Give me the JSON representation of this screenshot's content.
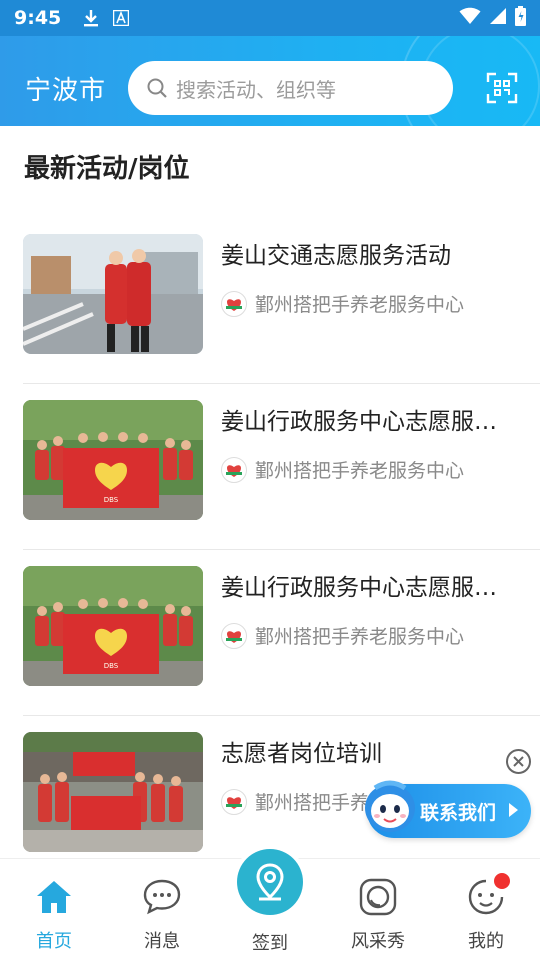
{
  "status_bar": {
    "time": "9:45",
    "icons": [
      "download-icon",
      "a-icon",
      "wifi-icon",
      "signal-icon",
      "battery-icon"
    ]
  },
  "header": {
    "city": "宁波市",
    "search_placeholder": "搜索活动、组织等",
    "scan_icon": "scan-icon",
    "accent": "#1fa9ef"
  },
  "section": {
    "title": "最新活动/岗位"
  },
  "items": [
    {
      "title": "姜山交通志愿服务活动",
      "org": "鄞州搭把手养老服务中心",
      "thumb": "traffic-volunteers-photo"
    },
    {
      "title": "姜山行政服务中心志愿服…",
      "org": "鄞州搭把手养老服务中心",
      "thumb": "group-with-banner-photo"
    },
    {
      "title": "姜山行政服务中心志愿服…",
      "org": "鄞州搭把手养老服务中心",
      "thumb": "group-with-banner-photo"
    },
    {
      "title": "志愿者岗位培训",
      "org": "鄞州搭把手养老服务中心",
      "thumb": "training-group-photo"
    }
  ],
  "float": {
    "contact_label": "联系我们"
  },
  "tabs": [
    {
      "label": "首页",
      "icon": "home-icon",
      "active": true
    },
    {
      "label": "消息",
      "icon": "chat-icon",
      "active": false
    },
    {
      "label": "签到",
      "icon": "location-pin-icon",
      "active": false
    },
    {
      "label": "风采秀",
      "icon": "camera-ring-icon",
      "active": false
    },
    {
      "label": "我的",
      "icon": "smile-face-icon",
      "active": false
    }
  ],
  "colors": {
    "tab_active": "#26a8de",
    "center_button": "#2bb3cf",
    "badge": "#f0312f"
  }
}
